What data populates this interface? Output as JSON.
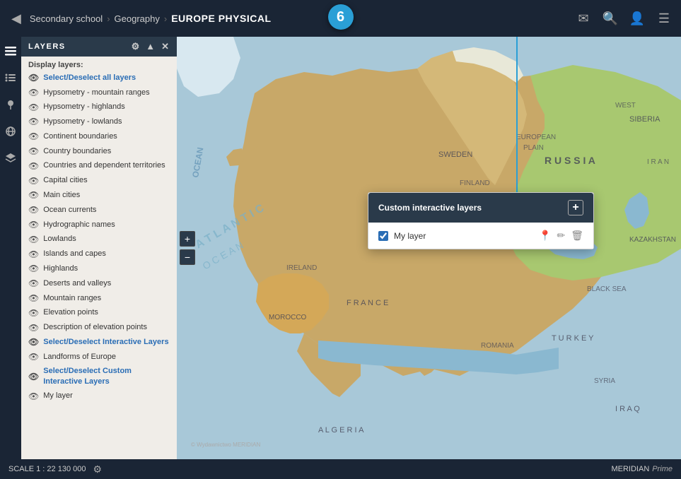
{
  "header": {
    "back_label": "◀",
    "breadcrumb": [
      "Secondary school",
      "Geography"
    ],
    "title": "EUROPE PHYSICAL",
    "separator": "›",
    "icons": [
      "✉",
      "🔍",
      "👤",
      "☰"
    ]
  },
  "step_indicator": "6",
  "sidebar": {
    "icon_items": [
      "layers",
      "list",
      "pin",
      "globe",
      "layers2"
    ]
  },
  "layers_panel": {
    "title": "LAYERS",
    "header_icons": [
      "gear",
      "up",
      "close"
    ],
    "display_label": "Display layers:",
    "items": [
      {
        "text": "Select/Deselect all layers",
        "bold": true
      },
      {
        "text": "Hypsometry - mountain ranges",
        "bold": false
      },
      {
        "text": "Hypsometry - highlands",
        "bold": false
      },
      {
        "text": "Hypsometry - lowlands",
        "bold": false
      },
      {
        "text": "Continent boundaries",
        "bold": false
      },
      {
        "text": "Country boundaries",
        "bold": false
      },
      {
        "text": "Countries and dependent territories",
        "bold": false
      },
      {
        "text": "Capital cities",
        "bold": false
      },
      {
        "text": "Main cities",
        "bold": false
      },
      {
        "text": "Ocean currents",
        "bold": false
      },
      {
        "text": "Hydrographic names",
        "bold": false
      },
      {
        "text": "Lowlands",
        "bold": false
      },
      {
        "text": "Islands and capes",
        "bold": false
      },
      {
        "text": "Highlands",
        "bold": false
      },
      {
        "text": "Deserts and valleys",
        "bold": false
      },
      {
        "text": "Mountain ranges",
        "bold": false
      },
      {
        "text": "Elevation points",
        "bold": false
      },
      {
        "text": "Description of elevation points",
        "bold": false
      },
      {
        "text": "Select/Deselect Interactive Layers",
        "bold": true
      },
      {
        "text": "Landforms of Europe",
        "bold": false
      },
      {
        "text": "Select/Deselect Custom Interactive Layers",
        "bold": true
      },
      {
        "text": "My layer",
        "bold": false
      }
    ]
  },
  "popup": {
    "title": "Custom interactive layers",
    "add_label": "+",
    "layer": {
      "name": "My layer",
      "checked": true
    }
  },
  "bottom_bar": {
    "scale_label": "SCALE  1 : 22 130 000",
    "logo": "MERIDIAN",
    "logo_suffix": "Prime"
  },
  "colors": {
    "dark_bg": "#1a2535",
    "panel_bg": "#2a3a4a",
    "accent": "#2a9fd6",
    "highlight": "#2a6db5"
  }
}
